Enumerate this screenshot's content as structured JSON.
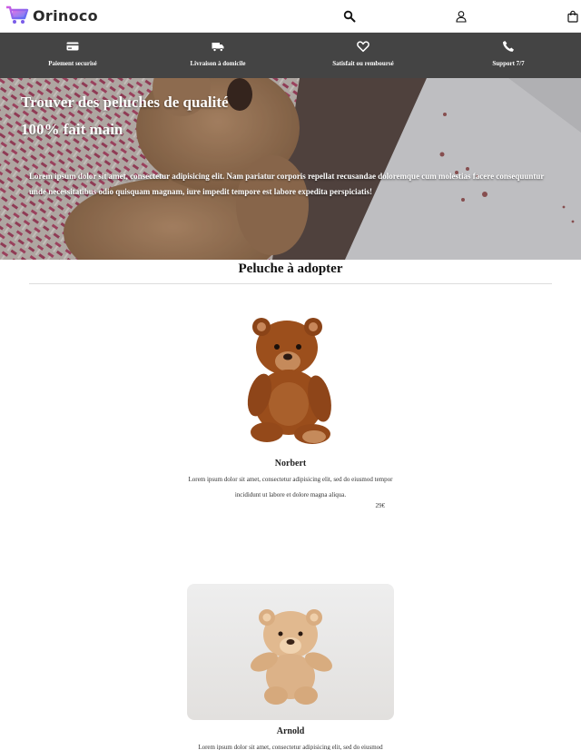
{
  "brand": {
    "name": "Orinoco"
  },
  "nav": {
    "icons": [
      "search-icon",
      "user-icon",
      "shopping-bag-icon"
    ]
  },
  "features": [
    {
      "label": "Paiement securisé",
      "icon": "credit-card-icon"
    },
    {
      "label": "Livraison à domicile",
      "icon": "truck-icon"
    },
    {
      "label": "Satisfait ou remboursé",
      "icon": "heart-icon"
    },
    {
      "label": "Support 7/7",
      "icon": "phone-icon"
    }
  ],
  "hero": {
    "title_line1": "Trouver des peluches de qualité",
    "title_line2": "100% fait main",
    "text": "Lorem ipsum dolor sit amet, consectetur adipisicing elit. Nam pariatur corporis repellat recusandae doloremque cum molestias facere consequuntur unde necessitatibus odio quisquam magnam, iure impedit tempore est labore expedita perspiciatis!"
  },
  "section": {
    "title": "Peluche à adopter"
  },
  "products": [
    {
      "name": "Norbert",
      "description": "Lorem ipsum dolor sit amet, consectetur adipisicing elit, sed do eiusmod tempor incididunt ut labore et dolore magna aliqua.",
      "price": "29€"
    },
    {
      "name": "Arnold",
      "description": "Lorem ipsum dolor sit amet, consectetur adipisicing elit, sed do eiusmod"
    }
  ],
  "colors": {
    "feature_band": "#444444",
    "logo_cart": "#9b5de5",
    "hero_overlay": "#6b5a50"
  }
}
